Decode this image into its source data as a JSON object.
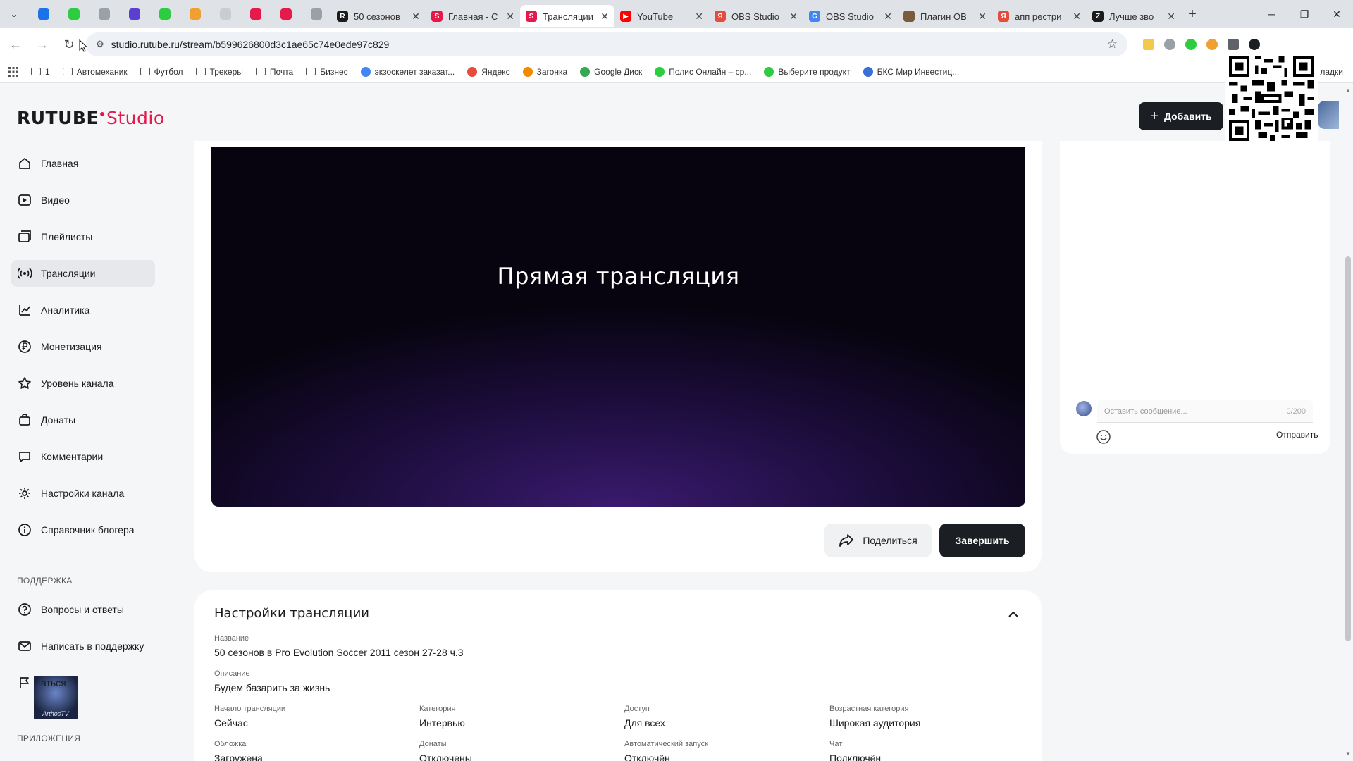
{
  "browser": {
    "tabs": [
      {
        "title": "50 сезонов",
        "favicon_color": "#1b1b1b",
        "favicon_letter": "R",
        "active": false
      },
      {
        "title": "Главная - С",
        "favicon_color": "#e6194b",
        "favicon_letter": "S",
        "active": false
      },
      {
        "title": "Трансляции",
        "favicon_color": "#e6194b",
        "favicon_letter": "S",
        "active": true
      },
      {
        "title": "YouTube",
        "favicon_color": "#ff0000",
        "favicon_letter": "▶",
        "active": false
      },
      {
        "title": "OBS Studio",
        "favicon_color": "#e64c3c",
        "favicon_letter": "Я",
        "active": false
      },
      {
        "title": "OBS Studio",
        "favicon_color": "#4285f4",
        "favicon_letter": "G",
        "active": false
      },
      {
        "title": "Плагин OB",
        "favicon_color": "#7a5c3c",
        "favicon_letter": "",
        "active": false
      },
      {
        "title": "апп рестри",
        "favicon_color": "#e64c3c",
        "favicon_letter": "Я",
        "active": false
      },
      {
        "title": "Лучше зво",
        "favicon_color": "#1b1b1b",
        "favicon_letter": "Z",
        "active": false
      }
    ],
    "pinned_colors": [
      "#1a73e8",
      "#2ecc40",
      "#9aa0a6",
      "#5b3fd1",
      "#2ecc40",
      "#f0a030",
      "#c9ccd1",
      "#e6194b",
      "#e6194b",
      "#9aa0a6"
    ],
    "url": "studio.rutube.ru/stream/b599626800d3c1ae65c74e0ede97c829",
    "bookmarks": [
      {
        "label": "1",
        "kind": "folder"
      },
      {
        "label": "Автомеханик",
        "kind": "folder"
      },
      {
        "label": "Футбол",
        "kind": "folder"
      },
      {
        "label": "Трекеры",
        "kind": "folder"
      },
      {
        "label": "Почта",
        "kind": "folder"
      },
      {
        "label": "Бизнес",
        "kind": "folder"
      },
      {
        "label": "экзоскелет заказат...",
        "kind": "site",
        "color": "#4285f4"
      },
      {
        "label": "Яндекс",
        "kind": "site",
        "color": "#e64c3c"
      },
      {
        "label": "Загонка",
        "kind": "site",
        "color": "#f08a00"
      },
      {
        "label": "Google Диск",
        "kind": "site",
        "color": "#34a853"
      },
      {
        "label": "Полис Онлайн – ср...",
        "kind": "site",
        "color": "#2ecc40"
      },
      {
        "label": "Выберите продукт",
        "kind": "site",
        "color": "#2ecc40"
      },
      {
        "label": "БКС Мир Инвестиц...",
        "kind": "site",
        "color": "#3a6fd8"
      }
    ],
    "bookmarks_overflow": "ладки"
  },
  "app": {
    "logo_main": "RUTUBE",
    "logo_dot": "●",
    "logo_studio": "Studio",
    "add_button": "Добавить"
  },
  "sidebar": {
    "items": [
      {
        "label": "Главная",
        "icon": "home-icon"
      },
      {
        "label": "Видео",
        "icon": "video-icon"
      },
      {
        "label": "Плейлисты",
        "icon": "playlist-icon"
      },
      {
        "label": "Трансляции",
        "icon": "broadcast-icon"
      },
      {
        "label": "Аналитика",
        "icon": "analytics-icon"
      },
      {
        "label": "Монетизация",
        "icon": "ruble-icon"
      },
      {
        "label": "Уровень канала",
        "icon": "star-icon"
      },
      {
        "label": "Донаты",
        "icon": "bag-icon"
      },
      {
        "label": "Комментарии",
        "icon": "comment-icon"
      },
      {
        "label": "Настройки канала",
        "icon": "gear-icon"
      },
      {
        "label": "Справочник блогера",
        "icon": "info-icon"
      }
    ],
    "support_heading": "ПОДДЕРЖКА",
    "support_items": [
      {
        "label": "Вопросы и ответы",
        "icon": "question-icon"
      },
      {
        "label": "Написать в поддержку",
        "icon": "mail-icon"
      },
      {
        "label": "аться",
        "icon": "flag-icon"
      }
    ],
    "apps_heading": "ПРИЛОЖЕНИЯ",
    "overlay_text": "ArthosTV"
  },
  "stream": {
    "player_title": "Прямая трансляция",
    "share_button": "Поделиться",
    "end_button": "Завершить"
  },
  "chat": {
    "placeholder": "Оставить сообщение...",
    "counter": "0/200",
    "send": "Отправить"
  },
  "settings": {
    "title": "Настройки трансляции",
    "name_label": "Название",
    "name_value": "50 сезонов в Pro Evolution Soccer 2011 сезон 27-28 ч.3",
    "description_label": "Описание",
    "description_value": "Будем базарить за жизнь",
    "start_label": "Начало трансляции",
    "start_value": "Сейчас",
    "category_label": "Категория",
    "category_value": "Интервью",
    "access_label": "Доступ",
    "access_value": "Для всех",
    "age_label": "Возрастная категория",
    "age_value": "Широкая аудитория",
    "cover_label": "Обложка",
    "cover_value": "Загружена",
    "donations_label": "Донаты",
    "donations_value": "Отключены",
    "autostart_label": "Автоматический запуск",
    "autostart_value": "Отключён",
    "chat_label": "Чат",
    "chat_value": "Подключён"
  }
}
